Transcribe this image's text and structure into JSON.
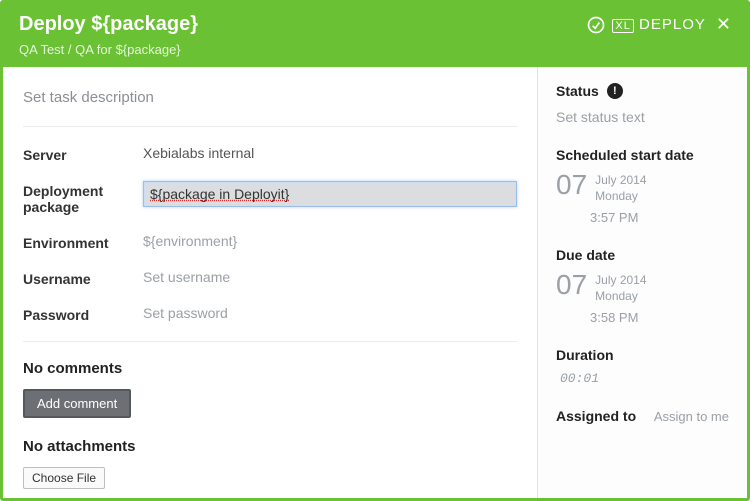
{
  "header": {
    "title": "Deploy ${package}",
    "breadcrumb": "QA Test / QA for ${package}",
    "brand": "DEPLOY",
    "brand_prefix": "XL"
  },
  "main": {
    "description_placeholder": "Set task description",
    "fields": {
      "server": {
        "label": "Server",
        "value": "Xebialabs internal"
      },
      "deployment_package": {
        "label": "Deployment package",
        "value": "${package in Deployit}"
      },
      "environment": {
        "label": "Environment",
        "placeholder": "${environment}"
      },
      "username": {
        "label": "Username",
        "placeholder": "Set username"
      },
      "password": {
        "label": "Password",
        "placeholder": "Set password"
      }
    },
    "comments": {
      "heading": "No comments",
      "add_button": "Add comment"
    },
    "attachments": {
      "heading": "No attachments",
      "choose_button": "Choose File"
    }
  },
  "sidebar": {
    "status": {
      "label": "Status",
      "placeholder": "Set status text"
    },
    "scheduled": {
      "label": "Scheduled start date",
      "day": "07",
      "month_year": "July 2014",
      "weekday": "Monday",
      "time": "3:57 PM"
    },
    "due": {
      "label": "Due date",
      "day": "07",
      "month_year": "July 2014",
      "weekday": "Monday",
      "time": "3:58 PM"
    },
    "duration": {
      "label": "Duration",
      "value": "00:01"
    },
    "assigned": {
      "label": "Assigned to",
      "link": "Assign to me"
    }
  }
}
